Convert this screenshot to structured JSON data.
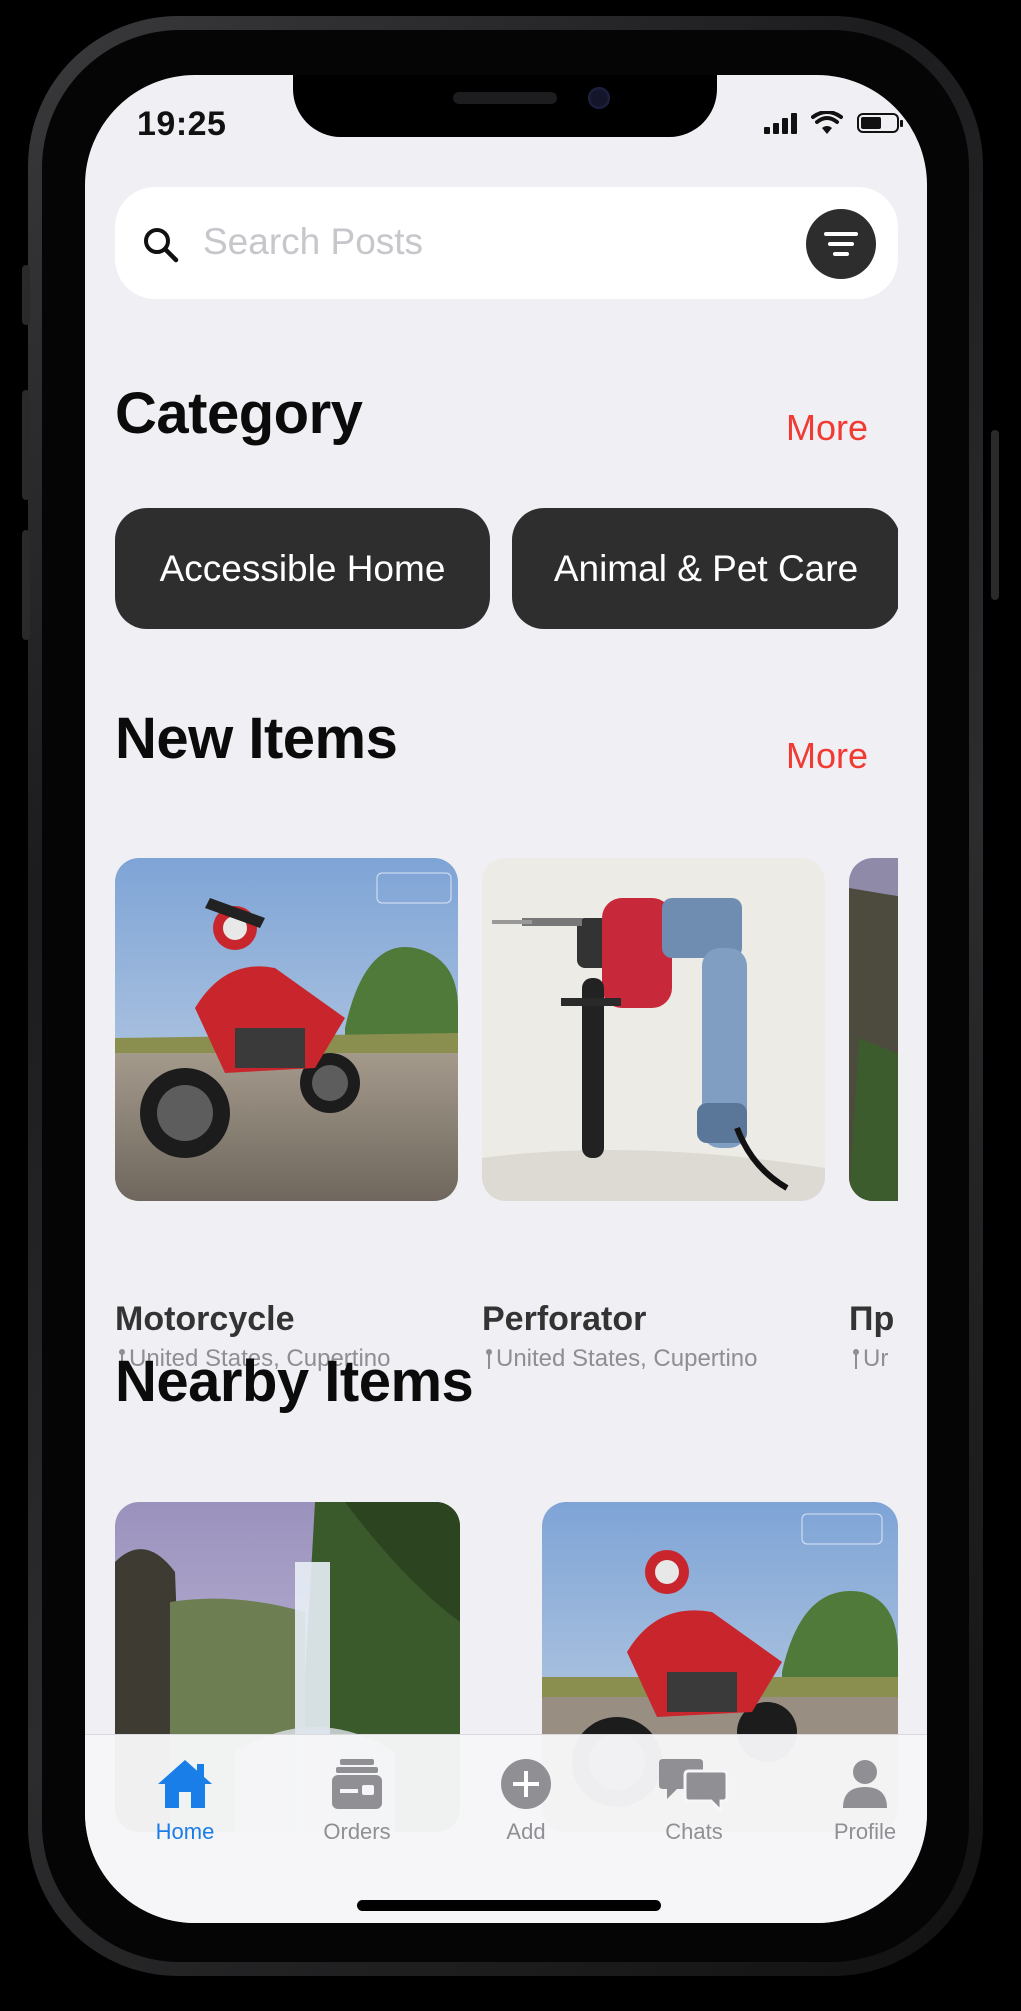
{
  "status_bar": {
    "time": "19:25",
    "battery_level": 0.6
  },
  "search": {
    "placeholder": "Search Posts"
  },
  "category": {
    "title": "Category",
    "more_label": "More",
    "chips": [
      "Accessible Home",
      "Animal & Pet Care"
    ]
  },
  "new_items": {
    "title": "New Items",
    "more_label": "More",
    "items": [
      {
        "title": "Motorcycle",
        "location": "United States, Cupertino"
      },
      {
        "title": "Perforator",
        "location": "United States, Cupertino"
      },
      {
        "title": "Пр",
        "location": "Ur"
      }
    ]
  },
  "nearby_items": {
    "title": "Nearby Items"
  },
  "tabbar": {
    "tabs": [
      {
        "label": "Home",
        "icon": "home-icon",
        "active": true
      },
      {
        "label": "Orders",
        "icon": "orders-icon"
      },
      {
        "label": "Add",
        "icon": "add-icon"
      },
      {
        "label": "Chats",
        "icon": "chats-icon"
      },
      {
        "label": "Profile",
        "icon": "profile-icon"
      }
    ]
  },
  "colors": {
    "accent": "#f03a32",
    "active_tab": "#1a7ee8",
    "chip_bg": "#2e2e2e",
    "background": "#efeff4"
  }
}
